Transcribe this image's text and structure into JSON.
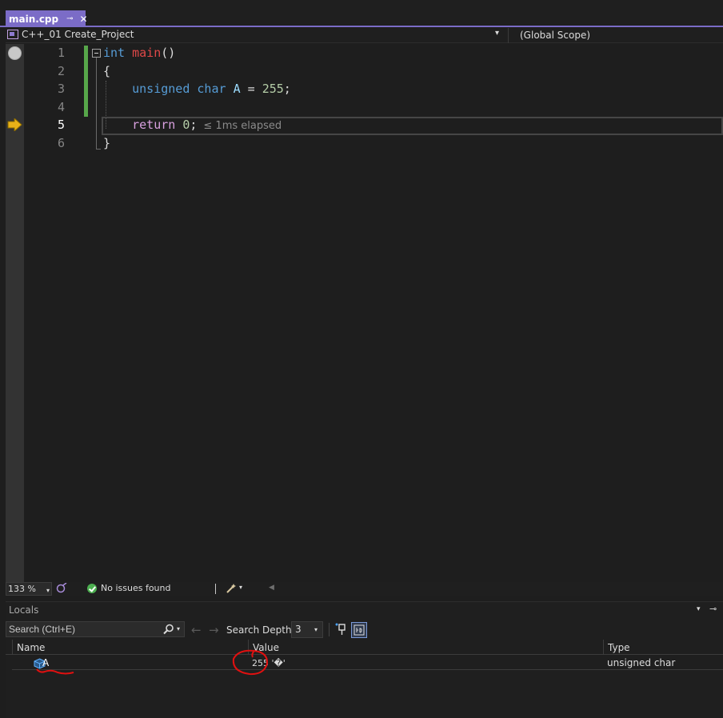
{
  "tab": {
    "filename": "main.cpp",
    "pin_glyph": "⊸",
    "close_glyph": "✕"
  },
  "navbar": {
    "project": "C++_01 Create_Project",
    "scope": "(Global Scope)",
    "dropdown_glyph": "▾"
  },
  "editor": {
    "line_numbers": [
      "1",
      "2",
      "3",
      "4",
      "5",
      "6"
    ],
    "current_line": 5,
    "code": {
      "line1": {
        "kw": "int",
        "fn": "main",
        "rest": "()"
      },
      "line2": "{",
      "line3": {
        "kw1": "unsigned",
        "kw2": "char",
        "var": "A",
        "op": " = ",
        "num": "255",
        "end": ";"
      },
      "line5": {
        "ctl": "return",
        "num": "0",
        "end": ";",
        "elapsed": "≤ 1ms elapsed"
      },
      "line6": "}"
    },
    "breakpoint_icon": "breakpoint-icon",
    "current_statement_icon": "execution-arrow-icon"
  },
  "status": {
    "zoom": "133 %",
    "issues": "No issues found",
    "dropdown_glyph": "▾",
    "scroll_left_glyph": "◀"
  },
  "locals": {
    "title": "Locals",
    "search_placeholder": "Search (Ctrl+E)",
    "search_depth_label": "Search Depth:",
    "search_depth_value": "3",
    "columns": {
      "name": "Name",
      "value": "Value",
      "type": "Type"
    },
    "rows": [
      {
        "name": "A",
        "value": "255 '�'",
        "type": "unsigned char"
      }
    ],
    "menu_glyph": "▾",
    "pin_glyph": "⊸",
    "back_glyph": "←",
    "forward_glyph": "→"
  },
  "colors": {
    "accent": "#7b6cc7",
    "change_bar": "#57a64a",
    "annotation": "#e01010"
  }
}
